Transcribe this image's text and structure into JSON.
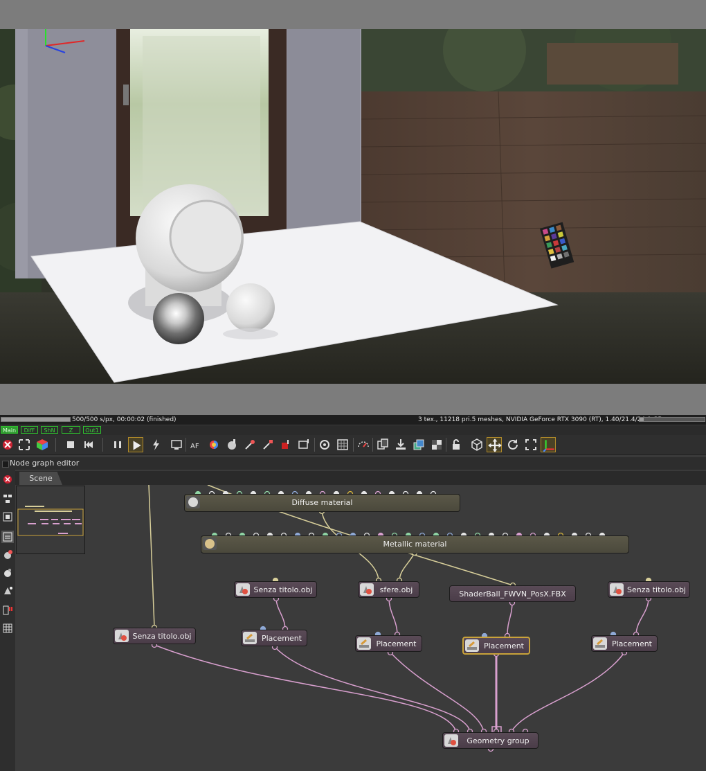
{
  "status": {
    "left_text": "500/500 s/px, 00:00:02 (finished)",
    "right_text": "3 tex., 11218 pri.5 meshes, NVIDIA GeForce RTX 3090 (RT), 1.40/21.4/24.0 GB",
    "render_progress": 1.0,
    "memory_fraction": 0.06
  },
  "passes": [
    {
      "label": "Main",
      "active": true
    },
    {
      "label": "DifF",
      "active": false
    },
    {
      "label": "ShN",
      "active": false
    },
    {
      "label": "Z",
      "active": false
    },
    {
      "label": "Out1",
      "active": false
    }
  ],
  "toolbar": {
    "icons": [
      "clear-icon",
      "fit-icon",
      "cube-color-icon",
      "stop-icon",
      "restart-icon",
      "pause-icon",
      "play-icon",
      "lightning-icon",
      "screen-icon",
      "af-icon",
      "color-picker-icon",
      "material-picker-icon",
      "pick-icon",
      "object-pick-icon",
      "white-balance-icon",
      "focus-picker-icon",
      "camera-lens-icon",
      "grid-icon",
      "dial-icon",
      "copy-icon",
      "export-icon",
      "layers-icon",
      "checker-icon",
      "lock-icon",
      "box-icon",
      "move-icon",
      "rotate-icon",
      "fullscreen-icon",
      "gizmo-icon"
    ]
  },
  "node_graph": {
    "title": "Node graph editor",
    "tab": "Scene"
  },
  "nodes": {
    "diffuse": "Diffuse material",
    "metallic": "Metallic material",
    "senza1": "Senza titolo.obj",
    "sfere": "sfere.obj",
    "shaderball": "ShaderBall_FWVN_PosX.FBX",
    "senza2": "Senza titolo.obj",
    "senza3": "Senza titolo.obj",
    "placement1": "Placement",
    "placement2": "Placement",
    "placement3": "Placement",
    "placement4": "Placement",
    "geometry_group": "Geometry group"
  },
  "colors": {
    "pin_green": "#8fd4a4",
    "pin_white": "#e4e4e4",
    "pin_blue": "#8fa9d6",
    "pin_pink": "#d9a0cf",
    "pin_yellow": "#d4b23a",
    "link_yellow": "#d8cf9a",
    "link_pink": "#d9a0cf",
    "selection": "#c9a33a"
  }
}
